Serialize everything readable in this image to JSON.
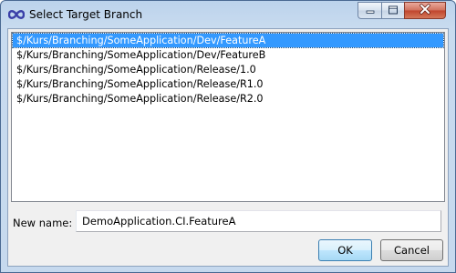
{
  "window": {
    "title": "Select Target Branch",
    "app_icon": "infinity-icon",
    "controls": {
      "minimize_icon": "minimize-icon",
      "maximize_icon": "maximize-icon",
      "close_icon": "close-icon"
    }
  },
  "branches": {
    "items": [
      "$/Kurs/Branching/SomeApplication/Dev/FeatureA",
      "$/Kurs/Branching/SomeApplication/Dev/FeatureB",
      "$/Kurs/Branching/SomeApplication/Release/1.0",
      "$/Kurs/Branching/SomeApplication/Release/R1.0",
      "$/Kurs/Branching/SomeApplication/Release/R2.0"
    ],
    "selected_index": 0
  },
  "new_name": {
    "label": "New name:",
    "value": "DemoApplication.CI.FeatureA"
  },
  "buttons": {
    "ok_label": "OK",
    "cancel_label": "Cancel"
  },
  "colors": {
    "selection": "#3399ff",
    "titlebar": "#bcd3ec",
    "close_button": "#c0442c"
  }
}
